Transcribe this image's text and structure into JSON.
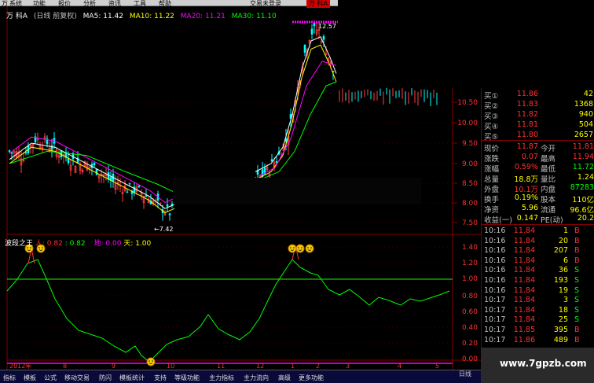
{
  "topbar": {
    "link": "交易未登录",
    "mark": "万 科A",
    "window_title": "万"
  },
  "menu": [
    "系统",
    "功能",
    "报价",
    "分析",
    "资讯",
    "工具",
    "帮助"
  ],
  "ma_line": {
    "stock": "万 科A",
    "period": "(日线 前复权)",
    "ma5": "MA5: 11.42",
    "ma10": "MA10: 11.22",
    "ma20": "MA20: 11.21",
    "ma30": "MA30: 11.10"
  },
  "colors": {
    "ma5": "#ffffff",
    "ma10": "#ffff00",
    "ma20": "#ff00ff",
    "ma30": "#00ff00",
    "up": "#ff4040",
    "down": "#00ffff",
    "grid": "#800000"
  },
  "price_axis": [
    "10.50",
    "10.00",
    "9.50",
    "9.00",
    "8.50",
    "8.00",
    "7.50"
  ],
  "indicator_axis": [
    "1.40",
    "1.20",
    "1.00",
    "0.80",
    "0.60",
    "0.40",
    "0.20",
    "0.00"
  ],
  "annotations": {
    "high": "12.57",
    "low": "←7.42"
  },
  "indicator": {
    "name": "波段之王",
    "ren": "人: 0.82",
    "v2": ": 0.82",
    "di": "地: 0.00",
    "tian": "天: 1.00"
  },
  "x_axis": [
    "2012年",
    "8",
    "9",
    "10",
    "11",
    "12",
    "1",
    "2",
    "3",
    "4",
    "5"
  ],
  "period_label": "日线",
  "bottom_tabs": [
    "指标",
    "模板",
    "公式",
    "移动交易",
    "防闪",
    "模板统计",
    "支持",
    "等级功能",
    "主力指标",
    "主力流向",
    "高级",
    "更多功能"
  ],
  "quotes": {
    "bids": [
      {
        "label": "买①",
        "price": "11.86",
        "vol": "42"
      },
      {
        "label": "买②",
        "price": "11.83",
        "vol": "1368"
      },
      {
        "label": "买③",
        "price": "11.82",
        "vol": "940"
      },
      {
        "label": "买④",
        "price": "11.81",
        "vol": "504"
      },
      {
        "label": "买⑤",
        "price": "11.80",
        "vol": "2657"
      }
    ],
    "stats": [
      {
        "l1": "现价",
        "v1": "11.87",
        "l2": "今开",
        "v2": "11.81"
      },
      {
        "l1": "涨跌",
        "v1": "0.07",
        "l2": "最高",
        "v2": "11.94"
      },
      {
        "l1": "涨幅",
        "v1": "0.59%",
        "l2": "最低",
        "v2": "11.72"
      },
      {
        "l1": "总量",
        "v1": "18.8万",
        "l2": "量比",
        "v2": "1.24"
      },
      {
        "l1": "外盘",
        "v1": "10.1万",
        "l2": "内盘",
        "v2": "87283"
      },
      {
        "l1": "换手",
        "v1": "0.19%",
        "l2": "股本",
        "v2": "110亿"
      },
      {
        "l1": "净资",
        "v1": "5.96",
        "l2": "流通",
        "v2": "96.6亿"
      },
      {
        "l1": "收益(一)",
        "v1": "0.147",
        "l2": "PE(动)",
        "v2": "20.2"
      }
    ],
    "ticks": [
      {
        "time": "10:16",
        "price": "11.84",
        "vol": "1",
        "side": "B"
      },
      {
        "time": "10:16",
        "price": "11.84",
        "vol": "20",
        "side": "B"
      },
      {
        "time": "10:16",
        "price": "11.84",
        "vol": "207",
        "side": "B"
      },
      {
        "time": "10:16",
        "price": "11.84",
        "vol": "6",
        "side": "B"
      },
      {
        "time": "10:16",
        "price": "11.84",
        "vol": "36",
        "side": "S"
      },
      {
        "time": "10:16",
        "price": "11.84",
        "vol": "193",
        "side": "S"
      },
      {
        "time": "10:16",
        "price": "11.84",
        "vol": "19",
        "side": "S"
      },
      {
        "time": "10:17",
        "price": "11.84",
        "vol": "3",
        "side": "S"
      },
      {
        "time": "10:17",
        "price": "11.84",
        "vol": "18",
        "side": "S"
      },
      {
        "time": "10:17",
        "price": "11.84",
        "vol": "25",
        "side": "S"
      },
      {
        "time": "10:17",
        "price": "11.85",
        "vol": "395",
        "side": "B"
      },
      {
        "time": "10:17",
        "price": "11.86",
        "vol": "489",
        "side": "B"
      }
    ]
  },
  "watermark": "www.7gpzb.com"
}
